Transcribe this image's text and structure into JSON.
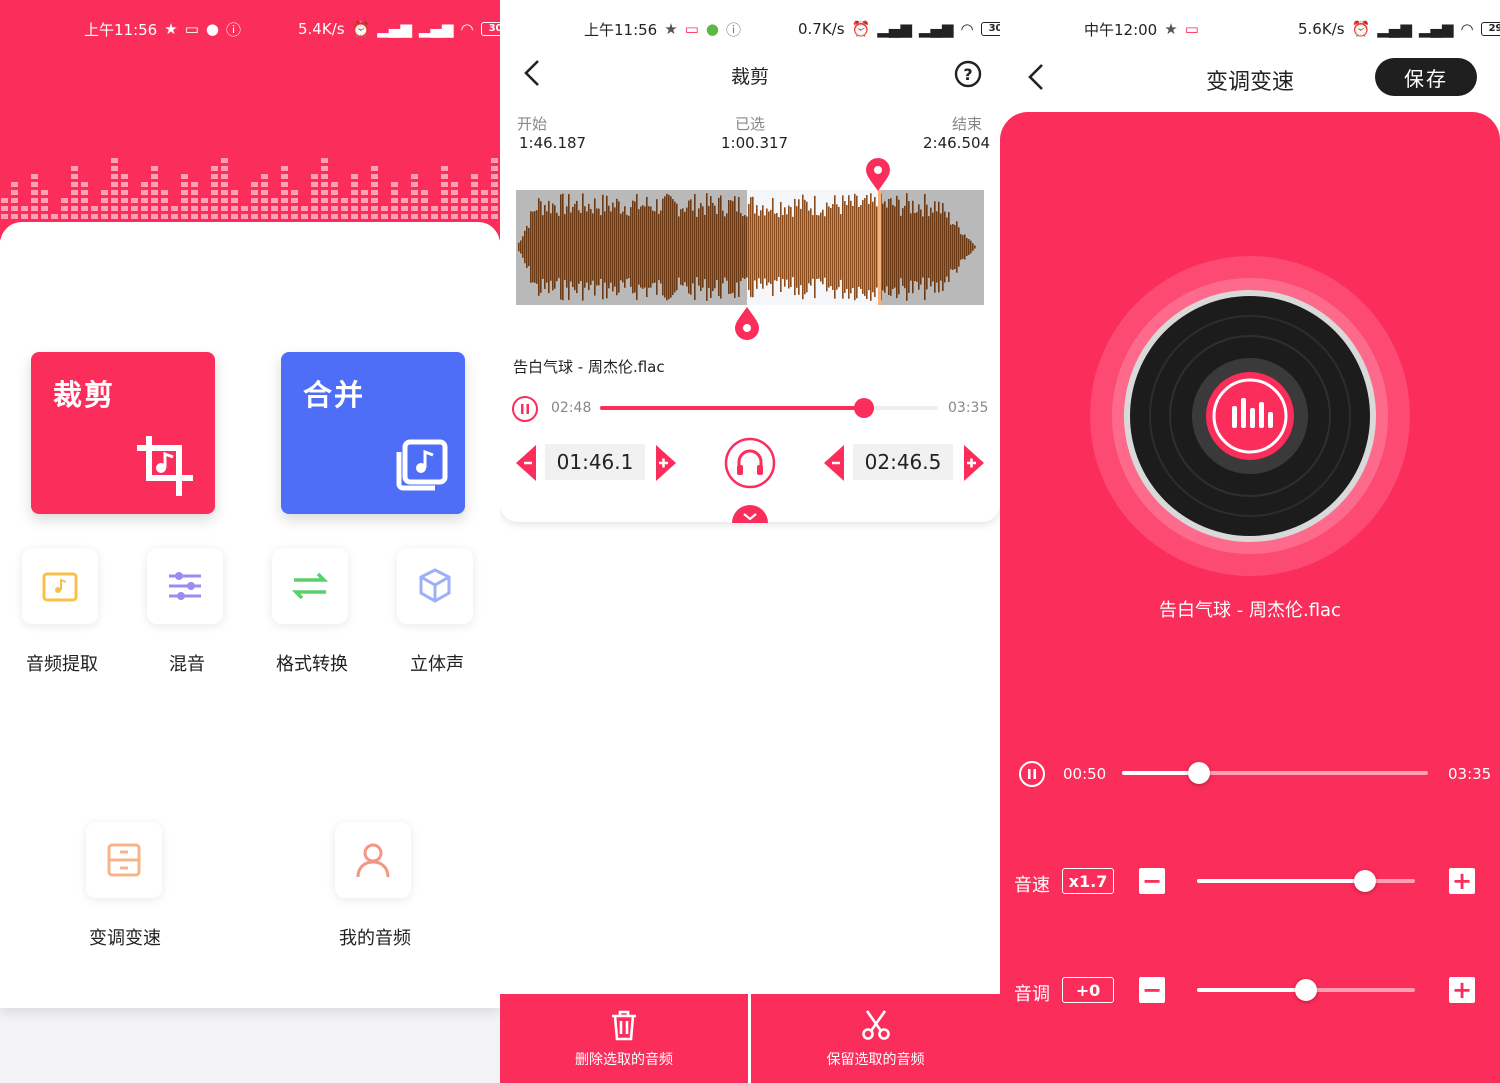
{
  "colors": {
    "accent": "#fb2d5a",
    "blue": "#4f6ef7",
    "dark": "#1f1f1f"
  },
  "home": {
    "status": {
      "time": "上午11:56",
      "speed": "5.4K/s",
      "battery": "30"
    },
    "tiles": {
      "crop": "裁剪",
      "merge": "合并"
    },
    "tools": [
      {
        "label": "音频提取",
        "icon": "audio-extract-icon"
      },
      {
        "label": "混音",
        "icon": "mixer-sliders-icon"
      },
      {
        "label": "格式转换",
        "icon": "convert-arrows-icon"
      },
      {
        "label": "立体声",
        "icon": "cube-icon"
      },
      {
        "label": "变调变速",
        "icon": "pitch-speed-icon"
      },
      {
        "label": "我的音频",
        "icon": "user-icon"
      }
    ]
  },
  "crop": {
    "status": {
      "time": "上午11:56",
      "speed": "0.7K/s",
      "battery": "30"
    },
    "title": "裁剪",
    "start_label": "开始",
    "start_value": "1:46.187",
    "selected_label": "已选",
    "selected_value": "1:00.317",
    "end_label": "结束",
    "end_value": "2:46.504",
    "filename": "告白气球 - 周杰伦.flac",
    "current_time": "02:48",
    "total_time": "03:35",
    "progress": 0.78,
    "start_box": "01:46.1",
    "end_box": "02:46.5",
    "delete_label": "删除选取的音频",
    "keep_label": "保留选取的音频"
  },
  "pitch": {
    "status": {
      "time": "中午12:00",
      "speed": "5.6K/s",
      "battery": "29"
    },
    "title": "变调变速",
    "save": "保存",
    "filename": "告白气球 - 周杰伦.flac",
    "current_time": "00:50",
    "total_time": "03:35",
    "progress": 0.25,
    "speed_label": "音速",
    "speed_value": "x1.7",
    "speed_level": 0.77,
    "tone_label": "音调",
    "tone_value": "+0",
    "tone_level": 0.5
  }
}
